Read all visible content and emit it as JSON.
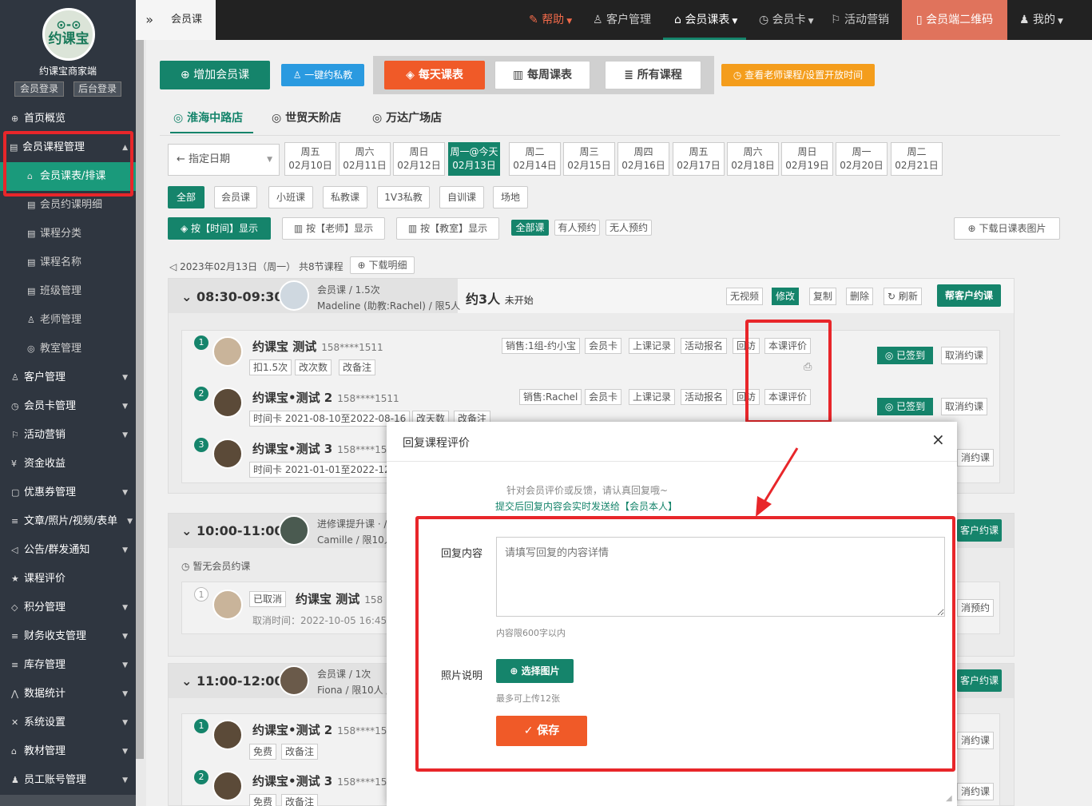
{
  "sidebar": {
    "logo_eyes": "⊙-⊙",
    "logo_text": "约课宝",
    "brand": "约课宝商家端",
    "login_member": "会员登录",
    "login_admin": "后台登录",
    "items": [
      {
        "label": "首页概览",
        "icon": "⊕"
      },
      {
        "label": "会员课程管理",
        "icon": "▤"
      },
      {
        "label": "会员课表/排课",
        "icon": "⌂"
      },
      {
        "label": "会员约课明细",
        "icon": "▤"
      },
      {
        "label": "课程分类",
        "icon": "▤"
      },
      {
        "label": "课程名称",
        "icon": "▤"
      },
      {
        "label": "班级管理",
        "icon": "▤"
      },
      {
        "label": "老师管理",
        "icon": "♙"
      },
      {
        "label": "教室管理",
        "icon": "◎"
      },
      {
        "label": "客户管理",
        "icon": "♙"
      },
      {
        "label": "会员卡管理",
        "icon": "◷"
      },
      {
        "label": "活动营销",
        "icon": "⚐"
      },
      {
        "label": "资金收益",
        "icon": "¥"
      },
      {
        "label": "优惠券管理",
        "icon": "▢"
      },
      {
        "label": "文章/照片/视频/表单",
        "icon": "≡"
      },
      {
        "label": "公告/群发通知",
        "icon": "◁"
      },
      {
        "label": "课程评价",
        "icon": "★"
      },
      {
        "label": "积分管理",
        "icon": "◇"
      },
      {
        "label": "财务收支管理",
        "icon": "≡"
      },
      {
        "label": "库存管理",
        "icon": "≡"
      },
      {
        "label": "数据统计",
        "icon": "⋀"
      },
      {
        "label": "系统设置",
        "icon": "✕"
      },
      {
        "label": "教材管理",
        "icon": "⌂"
      },
      {
        "label": "员工账号管理",
        "icon": "♟"
      }
    ]
  },
  "topbar": {
    "breadcrumb_icon": "»",
    "breadcrumb": "会员课",
    "help": "帮助",
    "customers": "客户管理",
    "schedule": "会员课表",
    "card": "会员卡",
    "marketing": "活动营销",
    "qrcode": "会员端二维码",
    "mine": "我的"
  },
  "toolbar": {
    "add_course": "增加会员课",
    "one_key": "一键约私教",
    "daily": "每天课表",
    "weekly": "每周课表",
    "all": "所有课程",
    "teacher_time": "查看老师课程/设置开放时间"
  },
  "stores": [
    "淮海中路店",
    "世贸天阶店",
    "万达广场店"
  ],
  "date_picker": "指定日期",
  "dates": [
    {
      "day": "周五",
      "date": "02月10日"
    },
    {
      "day": "周六",
      "date": "02月11日"
    },
    {
      "day": "周日",
      "date": "02月12日"
    },
    {
      "day": "周一@今天",
      "date": "02月13日"
    },
    {
      "day": "周二",
      "date": "02月14日"
    },
    {
      "day": "周三",
      "date": "02月15日"
    },
    {
      "day": "周四",
      "date": "02月16日"
    },
    {
      "day": "周五",
      "date": "02月17日"
    },
    {
      "day": "周六",
      "date": "02月18日"
    },
    {
      "day": "周日",
      "date": "02月19日"
    },
    {
      "day": "周一",
      "date": "02月20日"
    },
    {
      "day": "周二",
      "date": "02月21日"
    }
  ],
  "filters": [
    "全部",
    "会员课",
    "小班课",
    "私教课",
    "1V3私教",
    "自训课",
    "场地"
  ],
  "views": {
    "by_time": "按【时间】显示",
    "by_teacher": "按【老师】显示",
    "by_room": "按【教室】显示",
    "all_courses": "全部课",
    "booked": "有人预约",
    "unbooked": "无人预约",
    "download_img": "下载日课表图片"
  },
  "day_summary": "2023年02月13日（周一） 共8节课程",
  "download_detail": "下载明细",
  "course1": {
    "time": "08:30-09:30",
    "type": "会员课 / 1.5次",
    "teacher": "Madeline (助教:Rachel) / 限5人",
    "booked": "约3人",
    "status": "未开始",
    "btn_nv": "无视频",
    "btn_edit": "修改",
    "btn_copy": "复制",
    "btn_del": "删除",
    "btn_refresh": "刷新",
    "btn_help_book": "帮客户约课",
    "students": [
      {
        "num": "1",
        "name": "约课宝 测试",
        "phone": "158****1511",
        "sales": "销售:1组-约小宝",
        "t1": "扣1.5次",
        "t2": "改次数",
        "t3": "改备注"
      },
      {
        "num": "2",
        "name": "约课宝•测试 2",
        "phone": "158****1511",
        "sales": "销售:Rachel",
        "t1": "时间卡 2021-08-10至2022-08-16",
        "t2": "改天数",
        "t3": "改备注"
      },
      {
        "num": "3",
        "name": "约课宝•测试 3",
        "phone": "158****151",
        "sales": "",
        "t1": "时间卡 2021-01-01至2022-12",
        "t2": "",
        "t3": ""
      }
    ],
    "s_card": "会员卡",
    "s_record": "上课记录",
    "s_activity": "活动报名",
    "s_reply": "回访",
    "s_eval": "本课评价",
    "s_checked": "已签到",
    "s_cancel": "取消约课",
    "s_cancel_short": "消约课"
  },
  "course2": {
    "time": "10:00-11:00",
    "type": "进修课提升课 · /",
    "teacher": "Camille / 限10人",
    "help_book_short": "客户约课",
    "no_booking": "暂无会员约课",
    "cancel_num": "1",
    "cancelled": "已取消",
    "student": "约课宝 测试",
    "phone": "158",
    "cancel_time": "取消时间：2022-10-05 16:45:3",
    "cancel_short": "消预约"
  },
  "course3": {
    "time": "11:00-12:00",
    "type": "会员课 / 1次",
    "teacher": "Fiona / 限10人 /",
    "help_book_short": "客户约课",
    "students": [
      {
        "num": "1",
        "name": "约课宝•测试 2",
        "phone": "158****151",
        "t1": "免费",
        "t2": "改备注"
      },
      {
        "num": "2",
        "name": "约课宝•测试 3",
        "phone": "158****151",
        "t1": "免费",
        "t2": "改备注"
      }
    ],
    "cancel_short": "消约课"
  },
  "modal": {
    "title": "回复课程评价",
    "tip1": "针对会员评价或反馈，请认真回复哦~",
    "tip2": "提交后回复内容会实时发送给【会员本人】",
    "reply_label": "回复内容",
    "reply_placeholder": "请填写回复的内容详情",
    "limit": "内容限600字以内",
    "photo_label": "照片说明",
    "choose_photo": "选择图片",
    "photo_limit": "最多可上传12张",
    "save": "保存"
  },
  "colors": {
    "accent": "#15846b",
    "highlight": "#e8262a",
    "save": "#f05a28"
  }
}
